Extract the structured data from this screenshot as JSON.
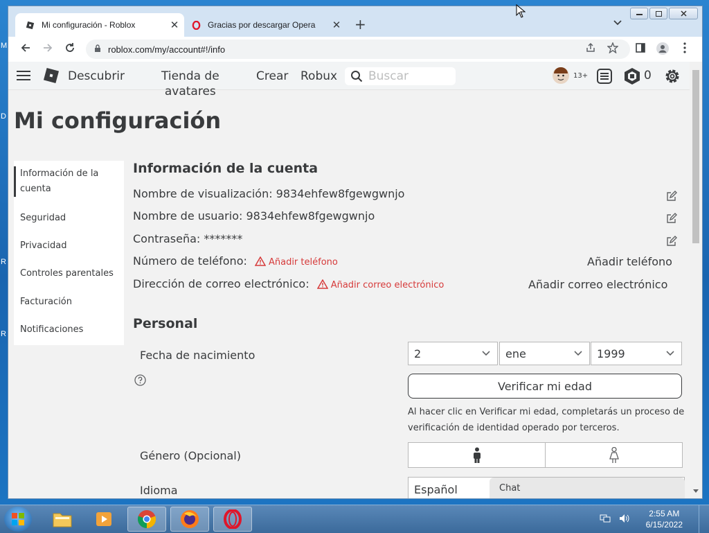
{
  "desktop": {
    "letters": [
      "M",
      "D",
      "R",
      "R"
    ]
  },
  "browser": {
    "tabs": [
      {
        "title": "Mi configuración - Roblox"
      },
      {
        "title": "Gracias por descargar Opera"
      }
    ],
    "new_tab_symbol": "+",
    "tab_search_symbol": "⌄",
    "address": "roblox.com/my/account#!/info",
    "window_buttons": {
      "minimize": "▭",
      "maximize": "▢",
      "close": "✕"
    }
  },
  "roblox_header": {
    "nav": {
      "discover": "Descubrir",
      "avatar_shop_line1": "Tienda de",
      "avatar_shop_line2": "avatares",
      "create": "Crear",
      "robux": "Robux"
    },
    "search_placeholder": "Buscar",
    "age_badge": "13+",
    "robux_count": "0"
  },
  "page": {
    "title": "Mi configuración",
    "menu": [
      {
        "label": "Información de la cuenta"
      },
      {
        "label": "Seguridad"
      },
      {
        "label": "Privacidad"
      },
      {
        "label": "Controles parentales"
      },
      {
        "label": "Facturación"
      },
      {
        "label": "Notificaciones"
      }
    ],
    "account_info": {
      "heading": "Información de la cuenta",
      "display_name": "Nombre de visualización: 9834ehfew8fgewgwnjo",
      "username": "Nombre de usuario: 9834ehfew8fgewgwnjo",
      "password": "Contraseña: *******",
      "phone_label": "Número de teléfono:",
      "phone_warning": "Añadir teléfono",
      "phone_action": "Añadir teléfono",
      "email_label": "Dirección de correo electrónico:",
      "email_warning": "Añadir correo electrónico",
      "email_action": "Añadir correo electrónico"
    },
    "personal": {
      "heading": "Personal",
      "birthdate_label": "Fecha de nacimiento",
      "birth_day": "2",
      "birth_month": "ene",
      "birth_year": "1999",
      "verify_button": "Verificar mi edad",
      "verify_note": "Al hacer clic en Verificar mi edad, completarás un proceso de verificación de identidad operado por terceros.",
      "gender_label": "Género (Opcional)",
      "language_label": "Idioma",
      "language_value": "Español"
    },
    "chat_label": "Chat"
  },
  "taskbar": {
    "time": "2:55 AM",
    "date": "6/15/2022"
  }
}
